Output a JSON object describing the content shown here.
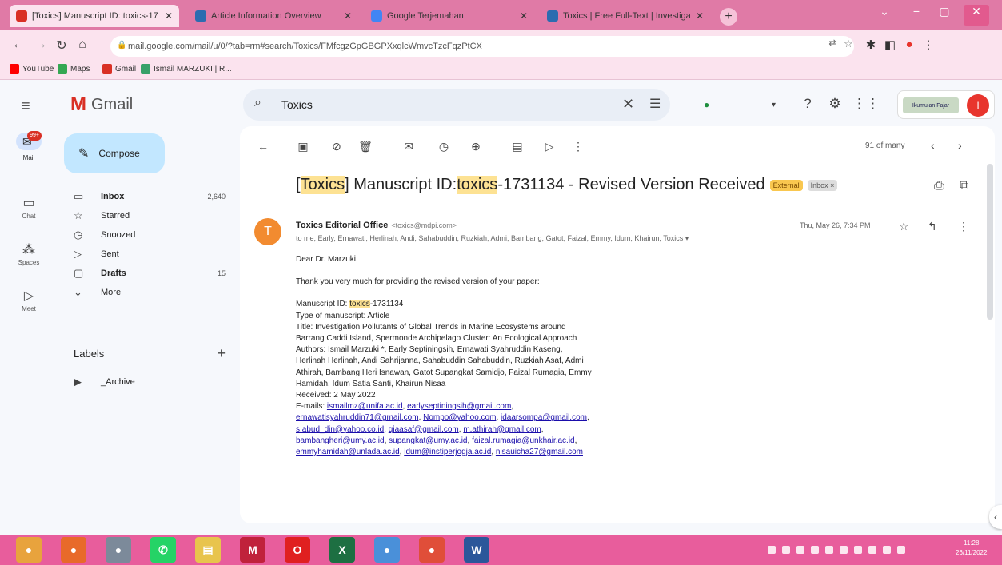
{
  "browser": {
    "tabs": [
      {
        "title": "[Toxics] Manuscript ID: toxics-17",
        "favicon": "gmail-icon",
        "color": "#d93025",
        "active": true
      },
      {
        "title": "Article Information Overview",
        "favicon": "article-icon",
        "color": "#2b6cb0",
        "active": false
      },
      {
        "title": "Google Terjemahan",
        "favicon": "translate-icon",
        "color": "#4285f4",
        "active": false
      },
      {
        "title": "Toxics | Free Full-Text | Investiga",
        "favicon": "mdpi-icon",
        "color": "#2b6cb0",
        "active": false
      }
    ],
    "url": "mail.google.com/mail/u/0/?tab=rm#search/Toxics/FMfcgzGpGBGPXxqlcWmvcTzcFqzPtCX",
    "bookmarks": [
      {
        "label": "YouTube",
        "color": "#ff0000"
      },
      {
        "label": "Maps",
        "color": "#34a853"
      },
      {
        "label": "Gmail",
        "color": "#d93025"
      },
      {
        "label": "Ismail MARZUKI | R...",
        "color": "#38a169"
      }
    ]
  },
  "gmail": {
    "brand": "Gmail",
    "search_value": "Toxics",
    "compose_label": "Compose",
    "rail": [
      {
        "label": "Mail",
        "badge": "99+"
      },
      {
        "label": "Chat"
      },
      {
        "label": "Spaces"
      },
      {
        "label": "Meet"
      }
    ],
    "nav": [
      {
        "label": "Inbox",
        "count": "2,640",
        "icon": "inbox-icon",
        "bold": true
      },
      {
        "label": "Starred",
        "count": "",
        "icon": "star-icon",
        "bold": false
      },
      {
        "label": "Snoozed",
        "count": "",
        "icon": "clock-icon",
        "bold": false
      },
      {
        "label": "Sent",
        "count": "",
        "icon": "send-icon",
        "bold": false
      },
      {
        "label": "Drafts",
        "count": "15",
        "icon": "draft-icon",
        "bold": true
      },
      {
        "label": "More",
        "count": "",
        "icon": "chevron-down-icon",
        "bold": false
      }
    ],
    "labels_heading": "Labels",
    "labels": [
      {
        "label": "_Archive"
      }
    ],
    "workspace_logo_text": "Ikumulan Fajar",
    "avatar_letter": "I"
  },
  "email": {
    "pager": "91 of many",
    "subject_prefix": "[",
    "subject_hl1": "Toxics",
    "subject_mid": "] Manuscript ID: ",
    "subject_hl2": "toxics",
    "subject_suffix": "-1731134 - Revised Version Received",
    "tag_external": "External",
    "tag_inbox": "Inbox ×",
    "sender_avatar": "T",
    "sender_name": "Toxics Editorial Office",
    "sender_email": "<toxics@mdpi.com>",
    "recipients": "to me, Early, Ernawati, Herlinah, Andi, Sahabuddin, Ruzkiah, Admi, Bambang, Gatot, Faizal, Emmy, Idum, Khairun, Toxics ▾",
    "date": "Thu, May 26, 7:34 PM",
    "greeting": "Dear Dr. Marzuki,",
    "thanks": "Thank you very much for providing the revised version of your paper:",
    "ms_prefix": "Manuscript ID: ",
    "ms_hl": "toxics",
    "ms_suffix": "-1731134",
    "type": "Type of manuscript: Article",
    "title_1": "Title: Investigation Pollutants of Global Trends in Marine Ecosystems around",
    "title_2": "Barrang Caddi Island, Spermonde Archipelago Cluster: An Ecological Approach",
    "authors_1": "Authors: Ismail Marzuki *, Early Septiningsih, Ernawati Syahruddin Kaseng,",
    "authors_2": "Herlinah Herlinah, Andi Sahrijanna, Sahabuddin Sahabuddin, Ruzkiah Asaf, Admi",
    "authors_3": "Athirah, Bambang Heri Isnawan, Gatot Supangkat Samidjo, Faizal Rumagia, Emmy",
    "authors_4": "Hamidah, Idum Satia Santi, Khairun Nisaa",
    "received": "Received: 2 May 2022",
    "emails_label": "E-mails: ",
    "emails_1a": "ismailmz@unifa.ac.id",
    "emails_1b": "earlyseptiningsih@gmail.com",
    "emails_2a": "ernawatisyahruddin71@gmail.com",
    "emails_2b": "Nompo@yahoo.com",
    "emails_2c": "idaarsompa@gmail.com",
    "emails_3a": "s.abud_din@yahoo.co.id",
    "emails_3b": "qiaasaf@gmail.com",
    "emails_3c": "m.athirah@gmail.com",
    "emails_4a": "bambangheri@umy.ac.id",
    "emails_4b": "supangkat@umy.ac.id",
    "emails_4c": "faizal.rumagia@unkhair.ac.id",
    "emails_5a": "emmyhamidah@unlada.ac.id",
    "emails_5b": "idum@instiperjogja.ac.id",
    "emails_5c": "nisauicha27@gmail.com"
  },
  "taskbar": {
    "apps": [
      {
        "name": "chrome-taskbar-icon",
        "color": "#e8a33d",
        "glyph": "●"
      },
      {
        "name": "firefox-taskbar-icon",
        "color": "#e86a2a",
        "glyph": "●"
      },
      {
        "name": "user-taskbar-icon",
        "color": "#7c8a9a",
        "glyph": "●"
      },
      {
        "name": "whatsapp-taskbar-icon",
        "color": "#25d366",
        "glyph": "✆"
      },
      {
        "name": "explorer-taskbar-icon",
        "color": "#e8c44d",
        "glyph": "▤"
      },
      {
        "name": "app-taskbar-icon",
        "color": "#c0223b",
        "glyph": "M"
      },
      {
        "name": "opera-taskbar-icon",
        "color": "#e02020",
        "glyph": "O"
      },
      {
        "name": "excel-taskbar-icon",
        "color": "#1d6f42",
        "glyph": "X"
      },
      {
        "name": "chrome2-taskbar-icon",
        "color": "#4a90d9",
        "glyph": "●"
      },
      {
        "name": "chrome3-taskbar-icon",
        "color": "#e04e39",
        "glyph": "●"
      },
      {
        "name": "word-taskbar-icon",
        "color": "#2b579a",
        "glyph": "W"
      }
    ],
    "time": "11:28",
    "date": "26/11/2022"
  }
}
